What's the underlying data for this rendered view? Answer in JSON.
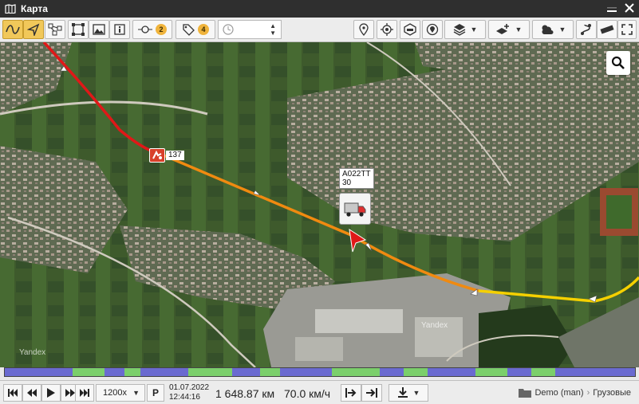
{
  "window": {
    "title": "Карта"
  },
  "map": {
    "vehicle": {
      "plate": "А022ТТ",
      "speed_label": "30"
    },
    "event_marker_label": "137",
    "watermark": "Yandex",
    "route_colors": {
      "fast": "#e01818",
      "medium": "#f08a10",
      "slow": "#f5d000"
    }
  },
  "toolbar": {
    "counters": {
      "points": "2",
      "tags": "4"
    },
    "icons": [
      "line-icon",
      "cursor-icon",
      "nodes-icon",
      "rectangle-icon",
      "image-icon",
      "info-icon",
      "point-icon",
      "tag-icon",
      "clock-icon",
      "pin-icon",
      "target-icon",
      "car-badge-icon",
      "location-icon",
      "layers-icon",
      "add-layer-icon",
      "weather-icon",
      "route-icon",
      "ruler-icon",
      "fullscreen-icon"
    ]
  },
  "playback": {
    "speed": "1200x",
    "p_label": "P",
    "date": "01.07.2022",
    "time": "12:44:16",
    "distance": "1 648.87 км",
    "velocity": "70.0 км/ч"
  },
  "breadcrumb": {
    "folder": "Demo (man)",
    "group": "Грузовые"
  }
}
